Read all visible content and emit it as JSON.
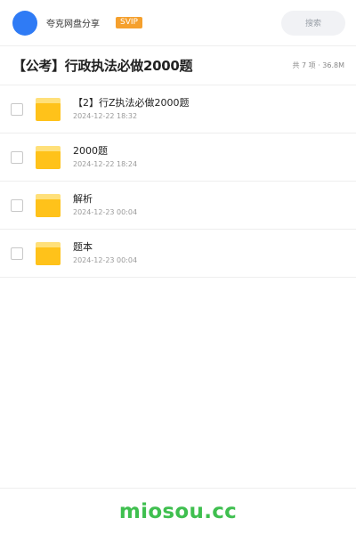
{
  "header": {
    "account_name": "夸克网盘分享",
    "badge": "SVIP",
    "search_placeholder": "搜索"
  },
  "folder": {
    "title": "【公考】行政执法必做2000题",
    "meta": "共 7 项 · 36.8M"
  },
  "files": [
    {
      "name": "【2】行Z执法必做2000题",
      "date": "2024-12-22 18:32",
      "icon": "folder-icon"
    },
    {
      "name": "2000题",
      "date": "2024-12-22 18:24",
      "icon": "folder-icon"
    },
    {
      "name": "解析",
      "date": "2024-12-23 00:04",
      "icon": "folder-icon"
    },
    {
      "name": "题本",
      "date": "2024-12-23 00:04",
      "icon": "folder-icon"
    }
  ],
  "footer": {
    "watermark": "miosou.cc"
  },
  "colors": {
    "avatar": "#2f7bf5",
    "badge": "#f5a02d",
    "folder": "#ffc21a",
    "watermark": "#3fbf4f"
  }
}
